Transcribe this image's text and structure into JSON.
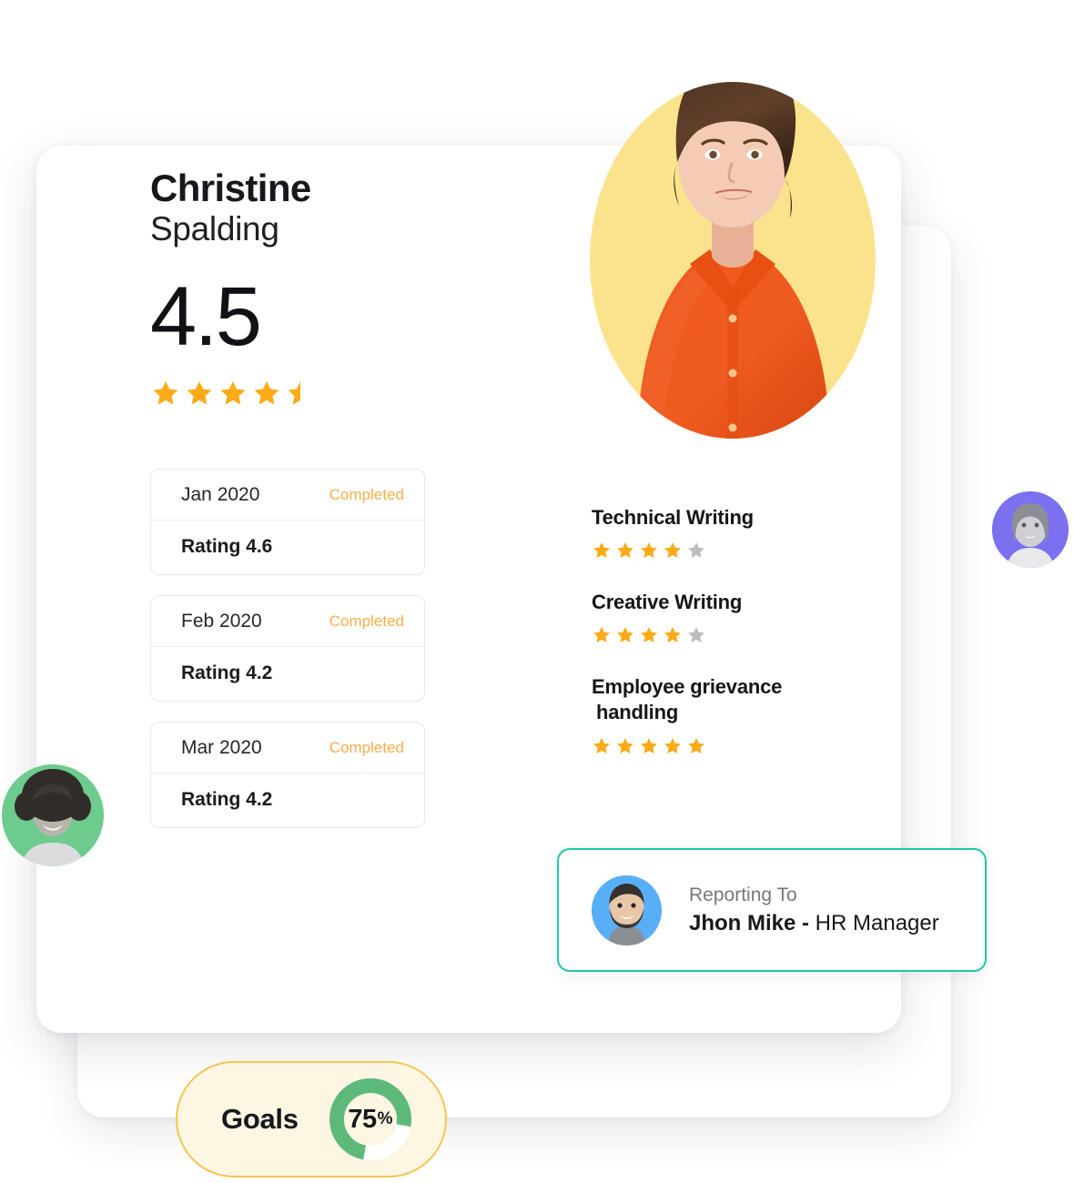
{
  "employee": {
    "first_name": "Christine",
    "last_name": "Spalding",
    "overall_score": "4.5",
    "overall_stars": 4.5,
    "photo_bg_color": "#fbe38d"
  },
  "timeline": {
    "entries": [
      {
        "month": "Jan 2020",
        "status": "Completed",
        "rating_label": "Rating 4.6"
      },
      {
        "month": "Feb 2020",
        "status": "Completed",
        "rating_label": "Rating 4.2"
      },
      {
        "month": "Mar 2020",
        "status": "Completed",
        "rating_label": "Rating 4.2"
      }
    ]
  },
  "skills": {
    "items": [
      {
        "name": "Technical Writing",
        "name_line2": "",
        "stars_filled": 4,
        "stars_total": 5
      },
      {
        "name": "Creative Writing",
        "name_line2": "",
        "stars_filled": 4,
        "stars_total": 5
      },
      {
        "name": "Employee grievance",
        "name_line2": "handling",
        "stars_filled": 5,
        "stars_total": 5
      }
    ]
  },
  "reporting": {
    "label": "Reporting To",
    "manager_name": "Jhon Mike -",
    "manager_role": " HR Manager",
    "avatar_bg_color": "#57b0f7",
    "border_color": "#1fc8a2"
  },
  "goals": {
    "label": "Goals",
    "percent_value": "75",
    "percent_symbol": "%",
    "percent": 75,
    "track_color": "#ffffff",
    "progress_color": "#5cb97a",
    "badge_bg_color": "#fdf6e3",
    "badge_border_color": "#f4c64e"
  },
  "floating_avatars": [
    {
      "name": "avatar-right",
      "bg_color": "#7b70f0"
    },
    {
      "name": "avatar-left",
      "bg_color": "#6ecb8e"
    }
  ],
  "colors": {
    "star_filled": "#fcaa16",
    "star_empty": "#bdbdbd",
    "status_text": "#f8ae4a"
  }
}
